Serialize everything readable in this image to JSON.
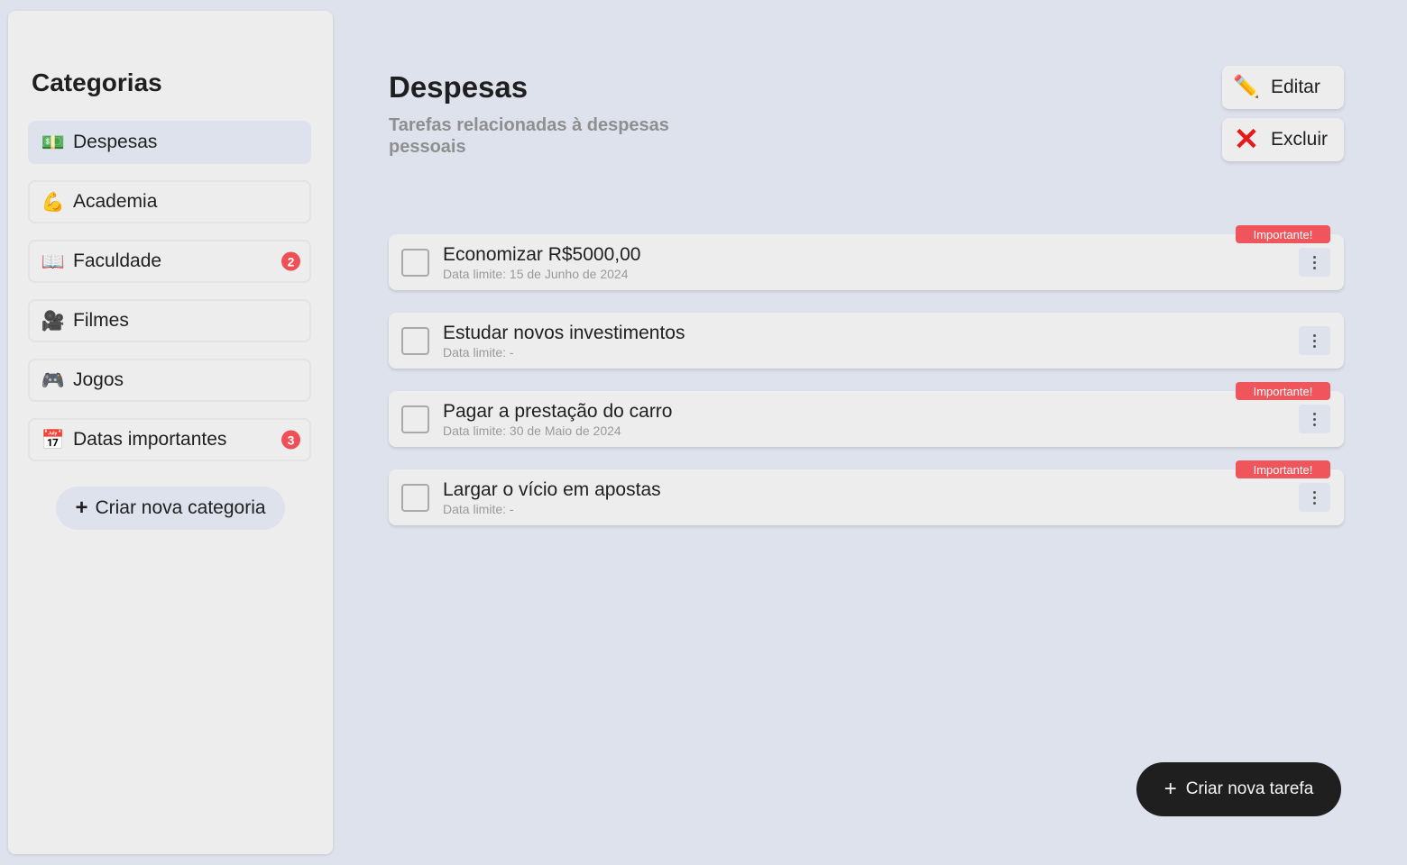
{
  "sidebar": {
    "title": "Categorias",
    "items": [
      {
        "icon": "💵",
        "label": "Despesas",
        "badge": "",
        "active": true
      },
      {
        "icon": "💪",
        "label": "Academia",
        "badge": "",
        "active": false
      },
      {
        "icon": "📖",
        "label": "Faculdade",
        "badge": "2",
        "active": false
      },
      {
        "icon": "🎥",
        "label": "Filmes",
        "badge": "",
        "active": false
      },
      {
        "icon": "🎮",
        "label": "Jogos",
        "badge": "",
        "active": false
      },
      {
        "icon": "📅",
        "label": "Datas importantes",
        "badge": "3",
        "active": false
      }
    ],
    "new_category_label": "Criar nova categoria",
    "new_category_plus": "+"
  },
  "main": {
    "title": "Despesas",
    "subtitle": "Tarefas relacionadas à despesas pessoais",
    "edit_icon": "✏️",
    "edit_label": "Editar",
    "delete_icon": "✕",
    "delete_label": "Excluir",
    "tasks": [
      {
        "title": "Economizar R$5000,00",
        "date": "Data limite: 15 de Junho de 2024",
        "tag": "Importante!"
      },
      {
        "title": "Estudar novos investimentos",
        "date": "Data limite: -",
        "tag": ""
      },
      {
        "title": "Pagar a prestação do carro",
        "date": "Data limite: 30 de Maio de 2024",
        "tag": "Importante!"
      },
      {
        "title": "Largar o vício em apostas",
        "date": "Data limite: -",
        "tag": "Importante!"
      }
    ],
    "new_task_label": "Criar nova tarefa",
    "new_task_plus": "+"
  },
  "colors": {
    "background": "#dee2ec",
    "panel": "#ededed",
    "badge": "#ef4f56",
    "tag": "#f0555b",
    "primary_button": "#1f1f1f"
  }
}
